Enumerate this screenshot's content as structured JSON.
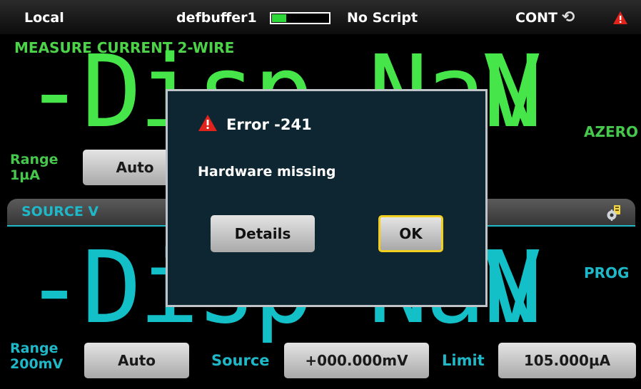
{
  "statusbar": {
    "mode": "Local",
    "buffer_name": "defbuffer1",
    "buffer_fill": 0.25,
    "script": "No Script",
    "trigger": "CONT",
    "trigger_icon": "sync-icon",
    "alert_icon": "warning-icon"
  },
  "measure": {
    "function_label": "MEASURE CURRENT 2-WIRE",
    "reading": "-Disp NaN",
    "unit": "V",
    "azero_label": "AZERO",
    "range_label_line1": "Range",
    "range_label_line2": "1µA",
    "range_value": "Auto"
  },
  "source": {
    "tab_label": "SOURCE V",
    "settings_icon": "settings-icon",
    "reading": "-Disp NaN",
    "unit": "V",
    "prog_label": "PROG",
    "range_label_line1": "Range",
    "range_label_line2": "200mV",
    "range_value": "Auto",
    "source_label": "Source",
    "source_value": "+000.000mV",
    "limit_label": "Limit",
    "limit_value": "105.000µA"
  },
  "dialog": {
    "icon": "warning-icon",
    "title": "Error  -241",
    "message": "Hardware missing",
    "details_label": "Details",
    "ok_label": "OK"
  },
  "colors": {
    "measure_accent": "#46e64a",
    "source_accent": "#1fb8c8",
    "dialog_bg": "#0d2632",
    "ok_focus_border": "#f2cf1f",
    "alert_red": "#e0231b"
  }
}
